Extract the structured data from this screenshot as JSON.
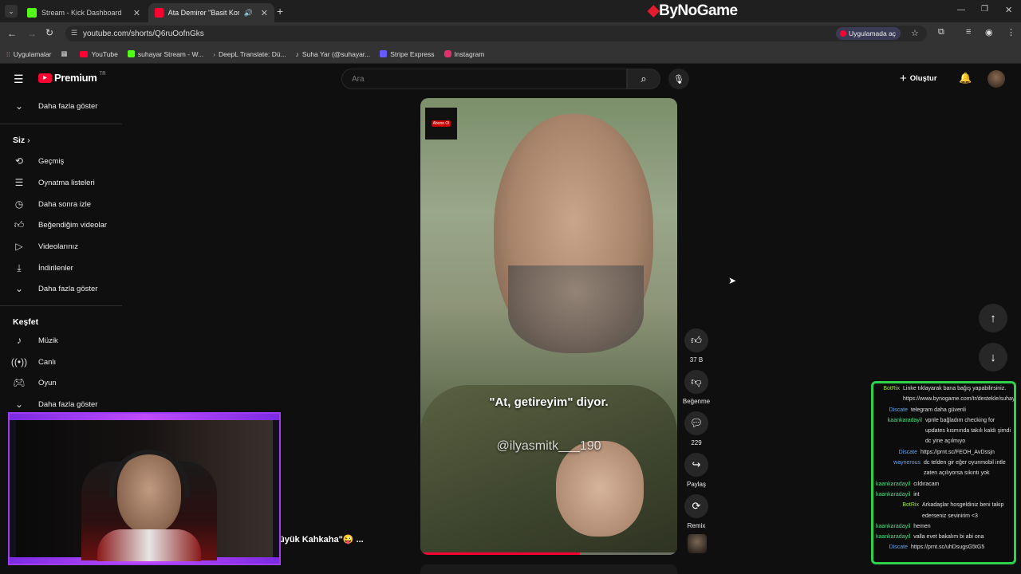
{
  "browser": {
    "tabs": [
      {
        "label": "Stream - Kick Dashboard",
        "favicon_color": "#53fc18"
      },
      {
        "label": "Ata Demirer \"Basit Konular",
        "favicon_color": "#ff0000"
      }
    ],
    "url": "youtube.com/shorts/Q6ruOofnGks",
    "open_in_app": "Uygulamada aç",
    "watermark": "ByNoGame",
    "bookmarks": [
      {
        "label": "Uygulamalar"
      },
      {
        "label": "YouTube"
      },
      {
        "label": "suhayar Stream - W..."
      },
      {
        "label": "DeepL Translate: Dü..."
      },
      {
        "label": "Suha Yar (@suhayar..."
      },
      {
        "label": "Stripe Express"
      },
      {
        "label": "Instagram"
      }
    ]
  },
  "header": {
    "logo": "Premium",
    "logo_sup": "TR",
    "search_placeholder": "Ara",
    "create_label": "Oluştur"
  },
  "sidebar": {
    "top_more": "Daha fazla göster",
    "you_heading": "Siz",
    "you_items": [
      {
        "label": "Geçmiş",
        "icon": "history-icon"
      },
      {
        "label": "Oynatma listeleri",
        "icon": "playlist-icon"
      },
      {
        "label": "Daha sonra izle",
        "icon": "clock-icon"
      },
      {
        "label": "Beğendiğim videolar",
        "icon": "thumbs-up-icon"
      },
      {
        "label": "Videolarınız",
        "icon": "video-icon"
      },
      {
        "label": "İndirilenler",
        "icon": "download-icon"
      },
      {
        "label": "Daha fazla göster",
        "icon": "chevron-down-icon"
      }
    ],
    "explore_heading": "Keşfet",
    "explore_items": [
      {
        "label": "Müzik",
        "icon": "music-icon"
      },
      {
        "label": "Canlı",
        "icon": "live-icon"
      },
      {
        "label": "Oyun",
        "icon": "gamepad-icon"
      },
      {
        "label": "Daha fazla göster",
        "icon": "chevron-down-icon"
      }
    ]
  },
  "video": {
    "caption": "\"At, getireyim\" diyor.",
    "handle": "@ilyasmitk___190",
    "subscribe_badge": "Abone Ol",
    "title_fragment": "üyük Kahkaha\"😜 ..."
  },
  "actions": {
    "likes": "37 B",
    "dislike_label": "Beğenme",
    "comments": "229",
    "share_label": "Paylaş",
    "remix_label": "Remix"
  },
  "chat": [
    {
      "user": "BotRix",
      "color": "#a3e635",
      "text": "Linke tıklayarak bana bağış yapabilirsiniz. https://www.bynogame.com/tr/destekle/suhayar"
    },
    {
      "user": "Discate",
      "color": "#60a5fa",
      "text": "telegram daha güvenli"
    },
    {
      "user": "kaankaradayil",
      "color": "#4ade80",
      "text": "vpnle bağladım checking for updates kısmında takılı kaldı şimdi dc yine açılmıyo"
    },
    {
      "user": "Discate",
      "color": "#60a5fa",
      "text": "https://prnt.sc/FEOH_AvDssjn"
    },
    {
      "user": "waynerous",
      "color": "#60a5fa",
      "text": "dc telden gir eğer oyunmobil intle zaten açılıyorsa sıkıntı yok"
    },
    {
      "user": "kaankaradayil",
      "color": "#4ade80",
      "text": "cıldıracam"
    },
    {
      "user": "kaankaradayil",
      "color": "#4ade80",
      "text": "int"
    },
    {
      "user": "BotRix",
      "color": "#a3e635",
      "text": "Arkadaşlar hosgeldiniz beni takip ederseniz sevinirim <3"
    },
    {
      "user": "kaankaradayil",
      "color": "#4ade80",
      "text": "hemen"
    },
    {
      "user": "kaankaradayil",
      "color": "#4ade80",
      "text": "valla evet bakalım bi abi ona"
    },
    {
      "user": "Discate",
      "color": "#60a5fa",
      "text": "https://prnt.sc/uhDsugsG5tG5"
    }
  ]
}
